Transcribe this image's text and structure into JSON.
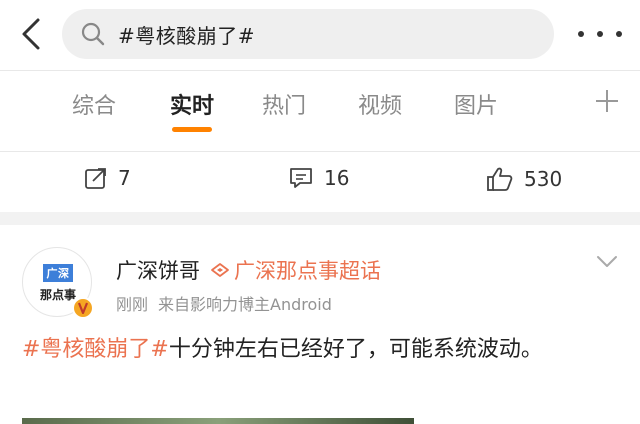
{
  "search": {
    "query": "#粤核酸崩了#"
  },
  "tabs": [
    {
      "label": "综合"
    },
    {
      "label": "实时"
    },
    {
      "label": "热门"
    },
    {
      "label": "视频"
    },
    {
      "label": "图片"
    }
  ],
  "actions": {
    "repost_count": "7",
    "comment_count": "16",
    "like_count": "530"
  },
  "post": {
    "avatar": {
      "top_text": "广深",
      "bottom_text": "那点事"
    },
    "author": "广深饼哥",
    "supertopic": "广深那点事超话",
    "time": "刚刚",
    "source": "来自影响力博主Android",
    "hashtag": "#粤核酸崩了#",
    "text": "十分钟左右已经好了，可能系统波动。"
  },
  "colors": {
    "accent": "#ff8200",
    "link": "#eb7350",
    "verified": "#f5a623"
  }
}
